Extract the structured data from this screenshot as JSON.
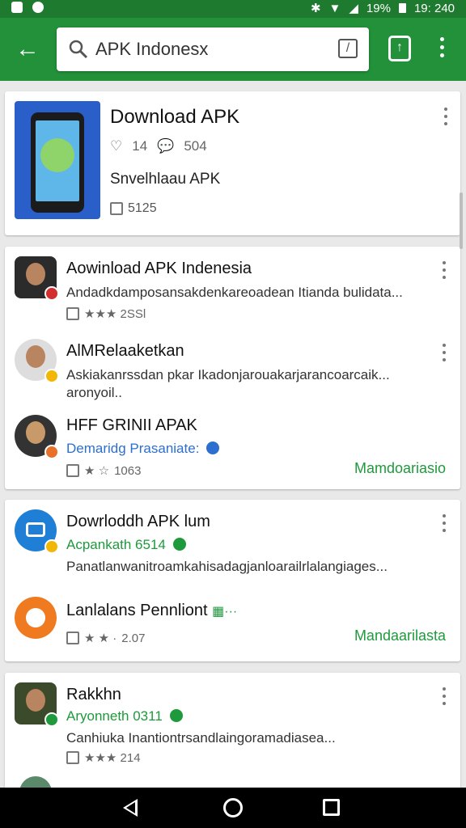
{
  "status_bar": {
    "battery": "19%",
    "time": "19: 240"
  },
  "app_bar": {
    "search_query": "APK Indonesx",
    "icons": {
      "back": "arrow-left-icon",
      "search": "magnifier-icon",
      "clear": "clear-box-icon",
      "share": "share-icon",
      "more": "more-vert-icon"
    }
  },
  "featured": {
    "title": "Download APK",
    "likes": "14",
    "comments": "504",
    "subtitle": "Snvelhlaau APK",
    "size": "5125"
  },
  "card1": {
    "items": [
      {
        "title": "Aowinload APK Indenesia",
        "desc": "Andadkdamposansakdenkareoadean Itianda bulidata...",
        "meta": "★★★ 2SSl"
      },
      {
        "title": "AlMRelaaketkan",
        "desc": "Askiakanrssdan pkar Ikadonjarouakarjarancoarcaik... aronyoil.."
      },
      {
        "title": "HFF GRINII APAK",
        "sub": "Demaridg Prasaniate:",
        "meta": "1063",
        "action": "Mamdoariasio"
      }
    ]
  },
  "card2": {
    "items": [
      {
        "title": "Dowrloddh APK lum",
        "sub": "Acpankath 6514",
        "desc": "Panatlanwanitroamkahisadagjanloarailrlalangiages..."
      },
      {
        "title": "Lanlalans Pennliont",
        "meta": "2.07",
        "action": "Mandaarilasta"
      }
    ]
  },
  "card3": {
    "items": [
      {
        "title": "Rakkhn",
        "sub": "Aryonneth 0311",
        "desc": "Canhiuka Inantiontrsandlaingoramadiasea...",
        "meta": "★★★ 214"
      }
    ]
  },
  "colors": {
    "app_bar": "#23913a",
    "status_bar": "#1e7a2f",
    "accent_green": "#1e9a3c",
    "link_blue": "#2c6fcf"
  }
}
